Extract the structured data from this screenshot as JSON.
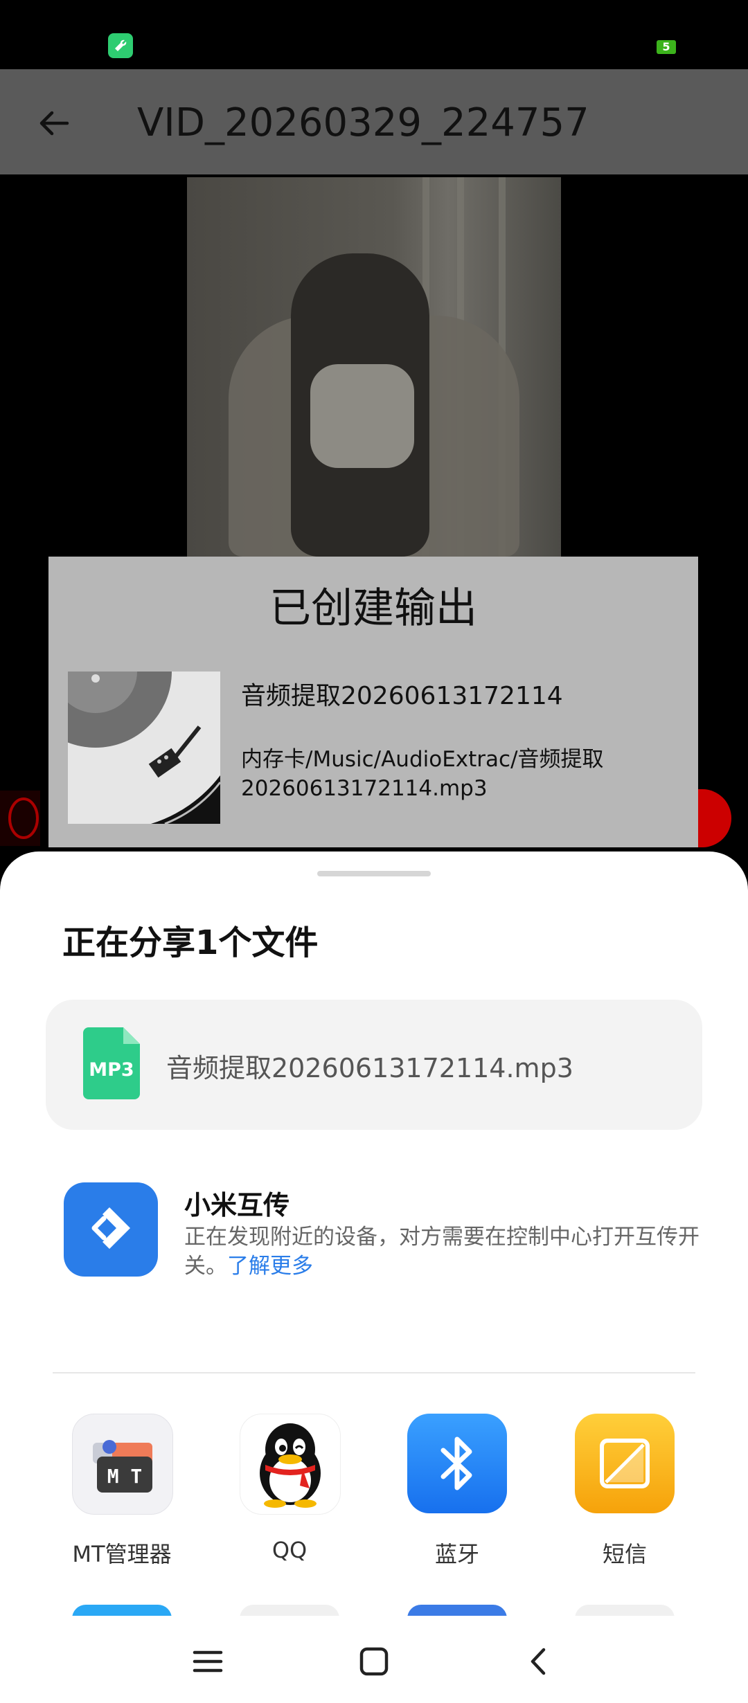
{
  "status_bar": {
    "app_icon": "wrench-icon",
    "battery_level": "5"
  },
  "app_bar": {
    "back_icon": "arrow-left-icon",
    "title": "VID_20260329_224757"
  },
  "dialog": {
    "title": "已创建输出",
    "thumbnail_icon": "turntable-image",
    "filename": "音频提取20260613172114",
    "path": "内存卡/Music/AudioExtrac/音频提取20260613172114.mp3"
  },
  "share_sheet": {
    "title": "正在分享1个文件",
    "file": {
      "icon": "mp3-file-icon",
      "icon_text": "MP3",
      "name": "音频提取20260613172114.mp3"
    },
    "mi_share": {
      "title": "小米互传",
      "description": "正在发现附近的设备，对方需要在控制中心打开互传开关。",
      "learn_more": "了解更多"
    },
    "apps": [
      {
        "label": "MT管理器",
        "icon": "mt-manager-icon",
        "icon_text": "M T"
      },
      {
        "label": "QQ",
        "icon": "qq-penguin-icon"
      },
      {
        "label": "蓝牙",
        "icon": "bluetooth-icon"
      },
      {
        "label": "短信",
        "icon": "sms-icon"
      }
    ]
  },
  "nav_bar": {
    "menu_icon": "menu-icon",
    "home_icon": "home-icon",
    "back_icon": "back-icon"
  },
  "colors": {
    "accent_blue": "#2a7de9",
    "mp3_green": "#2ecc8a",
    "bluetooth_blue": "#1e88f5",
    "sms_yellow": "#f6b30a"
  }
}
